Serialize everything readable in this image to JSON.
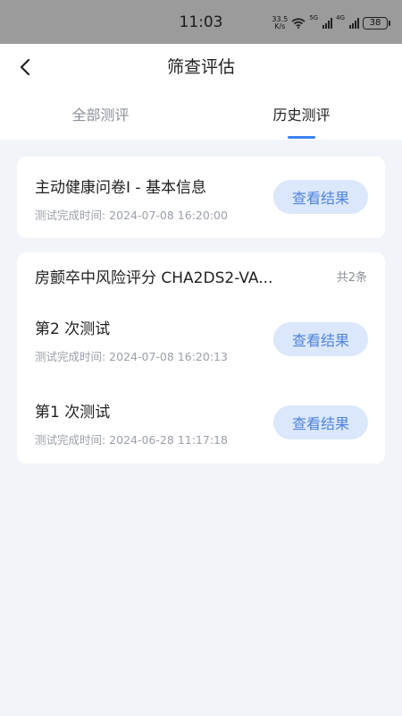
{
  "status_bar": {
    "time": "11:03",
    "net_speed_value": "33.5",
    "net_speed_unit": "K/s",
    "signal_1_label": "5G",
    "signal_2_label": "4G",
    "battery": "38",
    "icons": [
      "wifi-icon",
      "signal-icon",
      "signal-icon",
      "battery-icon"
    ]
  },
  "header": {
    "title": "筛查评估",
    "back_icon": "chevron-left-icon"
  },
  "tabs": [
    {
      "label": "全部测评",
      "active": false
    },
    {
      "label": "历史测评",
      "active": true
    }
  ],
  "cards": [
    {
      "title": "主动健康问卷I - 基本信息",
      "time": "测试完成时间: 2024-07-08 16:20:00",
      "button": "查看结果"
    }
  ],
  "group": {
    "title": "房颤卒中风险评分 CHA2DS2-VA...",
    "count": "共2条",
    "items": [
      {
        "title": "第2 次测试",
        "time": "测试完成时间: 2024-07-08 16:20:13",
        "button": "查看结果"
      },
      {
        "title": "第1 次测试",
        "time": "测试完成时间: 2024-06-28 11:17:18",
        "button": "查看结果"
      }
    ]
  },
  "colors": {
    "accent": "#3b82f6",
    "button_bg": "#dbe7fb",
    "button_text": "#4f84dc",
    "page_bg": "#f1f4f8"
  }
}
